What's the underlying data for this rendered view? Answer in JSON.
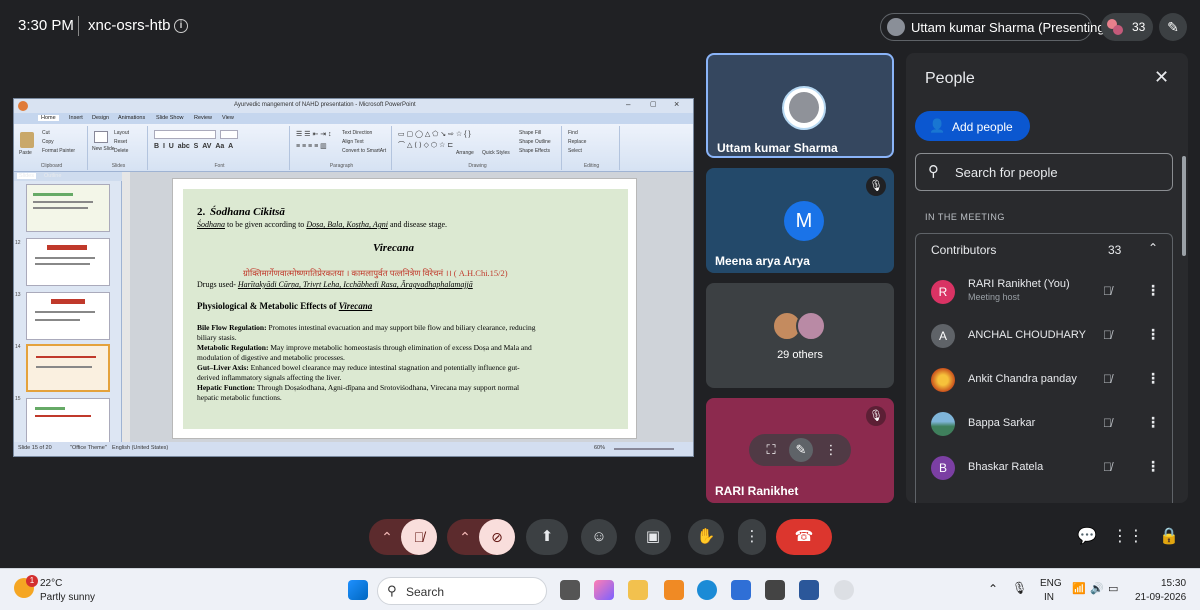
{
  "topbar": {
    "time": "3:30 PM",
    "meeting_code": "xnc-osrs-htb",
    "presenting_label": "Uttam kumar Sharma (Presenting)",
    "participant_count": "33"
  },
  "presentation": {
    "window_title": "Ayurvedic mangement of NAHD presentation - Microsoft PowerPoint",
    "ribbon_tabs": [
      "Home",
      "Insert",
      "Design",
      "Animations",
      "Slide Show",
      "Review",
      "View"
    ],
    "ribbon_groups": [
      "Clipboard",
      "Slides",
      "Font",
      "Paragraph",
      "Drawing",
      "Editing"
    ],
    "ribbon_items": {
      "paste": "Paste",
      "cut": "Cut",
      "copy": "Copy",
      "format_painter": "Format Painter",
      "new_slide": "New Slide",
      "layout": "Layout",
      "reset": "Reset",
      "delete": "Delete",
      "arrange": "Arrange",
      "quick_styles": "Quick Styles",
      "shape_fill": "Shape Fill",
      "shape_outline": "Shape Outline",
      "shape_effects": "Shape Effects",
      "find": "Find",
      "replace": "Replace",
      "select": "Select",
      "text_direction": "Text Direction",
      "align_text": "Align Text",
      "convert_smartart": "Convert to SmartArt"
    },
    "left_tabs": [
      "Slides",
      "Outline"
    ],
    "slide_numbers": [
      "",
      "12",
      "13",
      "14",
      "15"
    ],
    "status": {
      "slide": "Slide 15 of 20",
      "theme": "\"Office Theme\"",
      "language": "English (United States)",
      "zoom": "60%"
    },
    "slide": {
      "heading_num": "2.",
      "heading": "Śodhana Cikitsā",
      "line1_a": "Śodhana",
      "line1_b": " to be given according to ",
      "line1_c": "Doṣa, Bala, Koṣṭha, Agni",
      "line1_d": " and disease stage.",
      "subheading": "Virecana",
      "sanskrit": "ग्रोक्तिमार्गेणवात्मोष्णगतिप्रेरकतया । कामलापुर्वत पत्लनित्रेण विरेचनं ।। ( A.H.Chi.15/2)",
      "drugs_label": "Drugs used- ",
      "drugs": "Harītakyādi Cūrṇa, Trivṛt Leha, Icchābhedi Rasa, Āragvadhaphalamajjā",
      "effects_heading_a": "Physiological & Metabolic Effects of ",
      "effects_heading_b": "Virecana",
      "b1_title": "Bile Flow Regulation:",
      "b1_l1": " Promotes intestinal evacuation and may support bile flow and biliary clearance, reducing",
      "b1_l2": "biliary stasis.",
      "b2_title": "Metabolic Regulation:",
      "b2_l1": " May improve metabolic homeostasis through elimination of excess Doṣa and Mala and",
      "b2_l2": "modulation of digestive and metabolic processes.",
      "b3_title": "Gut–Liver Axis:",
      "b3_l1": " Enhanced bowel clearance may reduce intestinal stagnation and potentially influence gut-",
      "b3_l2": "derived inflammatory signals affecting the liver.",
      "b4_title": "Hepatic Function:",
      "b4_l1": " Through Doṣaśodhana, Agni-dīpana and Srotoviśodhana, Virecana may support normal",
      "b4_l2": "hepatic metabolic functions."
    }
  },
  "tiles": [
    {
      "name": "Uttam kumar Sharma"
    },
    {
      "name": "Meena arya Arya",
      "initial": "M"
    },
    {
      "name": "29 others"
    },
    {
      "name": "RARI Ranikhet"
    }
  ],
  "people_panel": {
    "title": "People",
    "add_people": "Add people",
    "search_placeholder": "Search for people",
    "section": "IN THE MEETING",
    "contributors_label": "Contributors",
    "contributors_count": "33",
    "participants": [
      {
        "name": "RARI Ranikhet (You)",
        "sub": "Meeting host",
        "initial": "R",
        "color": "#d93364"
      },
      {
        "name": "ANCHAL CHOUDHARY",
        "initial": "A",
        "color": "#5f6368"
      },
      {
        "name": "Ankit Chandra panday",
        "initial": "",
        "color": "#c9501c"
      },
      {
        "name": "Bappa Sarkar",
        "initial": "",
        "color": "#3f7f5c"
      },
      {
        "name": "Bhaskar Ratela",
        "initial": "B",
        "color": "#7b3fa3"
      }
    ]
  },
  "taskbar": {
    "weather_temp": "22°C",
    "weather_desc": "Partly sunny",
    "weather_badge": "1",
    "search_label": "Search",
    "lang_top": "ENG",
    "lang_bottom": "IN",
    "clock_time": "15:30",
    "clock_date": "21-09-2026"
  }
}
